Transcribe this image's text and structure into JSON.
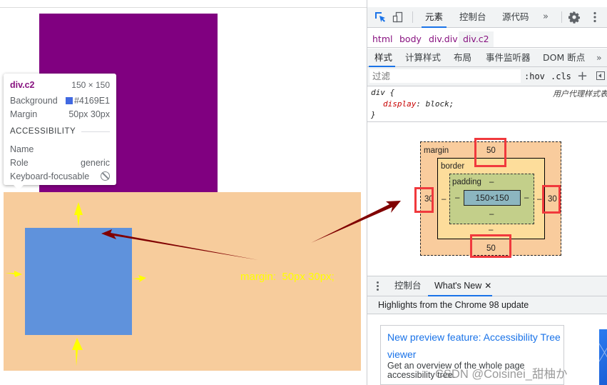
{
  "page": {
    "margin_annotation": "margin:  50px 30px;",
    "colors": {
      "outer_box": "#800080",
      "margin_area": "#f7cc9c",
      "inner_box": "#5f92dc",
      "annotation_text": "#ffff00",
      "annotation_arrow": "#800000"
    }
  },
  "tooltip": {
    "element": "div.c2",
    "dimensions": "150 × 150",
    "rows": [
      {
        "label": "Background",
        "value": "#4169E1",
        "swatch": "#4169E1"
      },
      {
        "label": "Margin",
        "value": "50px 30px"
      }
    ],
    "accessibility_heading": "ACCESSIBILITY",
    "accessibility": [
      {
        "label": "Name",
        "value": ""
      },
      {
        "label": "Role",
        "value": "generic"
      },
      {
        "label": "Keyboard-focusable",
        "value_icon": "not-allowed-icon"
      }
    ]
  },
  "devtools": {
    "toolbar": {
      "inspect_icon": "inspect-element-icon",
      "device_icon": "device-toolbar-icon",
      "tabs": [
        {
          "label": "元素",
          "active": true
        },
        {
          "label": "控制台",
          "active": false
        },
        {
          "label": "源代码",
          "active": false
        }
      ],
      "more": "»",
      "settings_icon": "gear-icon",
      "menu_icon": "kebab-menu-icon"
    },
    "breadcrumb": [
      "html",
      "body",
      "div.div",
      "div.c2"
    ],
    "subtabs": [
      {
        "label": "样式",
        "active": true
      },
      {
        "label": "计算样式",
        "active": false
      },
      {
        "label": "布局",
        "active": false
      },
      {
        "label": "事件监听器",
        "active": false
      },
      {
        "label": "DOM 断点",
        "active": false
      }
    ],
    "subtabs_more": "»",
    "filter": {
      "placeholder": "过滤",
      "hov": ":hov",
      "cls": ".cls",
      "plus": "+"
    },
    "style_rule": {
      "selector": "div {",
      "origin": "用户代理样式表",
      "property": "display",
      "value": "block;",
      "close": "}"
    },
    "box_model": {
      "margin_label": "margin",
      "border_label": "border",
      "padding_label": "padding",
      "content": "150×150",
      "margin": {
        "top": "50",
        "right": "30",
        "bottom": "50",
        "left": "30"
      },
      "border": {
        "top": "",
        "right": "–",
        "bottom": "–",
        "left": "–"
      },
      "padding": {
        "top": "–",
        "right": "–",
        "bottom": "–",
        "left": "–"
      }
    },
    "drawer": {
      "tabs": [
        {
          "label": "控制台",
          "active": false
        },
        {
          "label": "What's New",
          "active": true,
          "closable": true
        }
      ],
      "close_glyph": "✕",
      "header": "Highlights from the Chrome 98 update",
      "card": {
        "title": "New preview feature: Accessibility Tree viewer",
        "description": "Get an overview of the whole page accessibility tree."
      }
    }
  },
  "watermark": "CSDN @Coisinei_甜柚か"
}
